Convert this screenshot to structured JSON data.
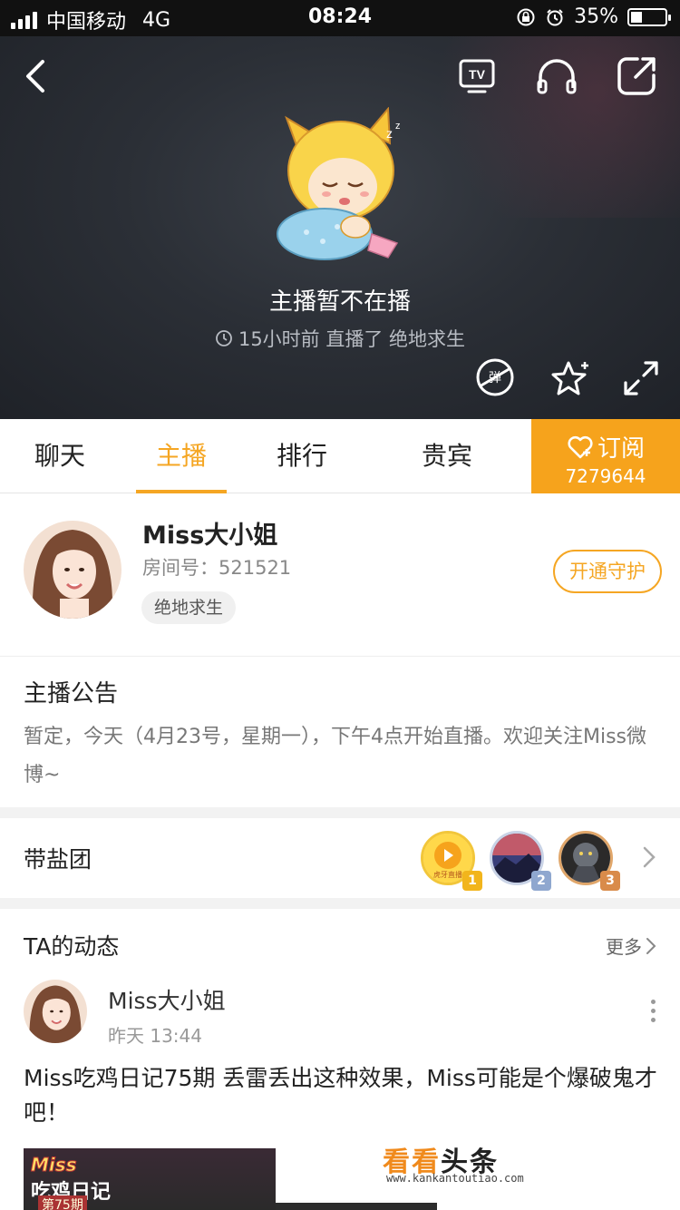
{
  "status_bar": {
    "carrier": "中国移动",
    "network": "4G",
    "time": "08:24",
    "battery": "35%"
  },
  "player": {
    "offline_title": "主播暂不在播",
    "offline_sub": "15小时前 直播了 绝地求生",
    "danmaku_label": "弹"
  },
  "tabs": [
    {
      "label": "聊天"
    },
    {
      "label": "主播"
    },
    {
      "label": "排行"
    },
    {
      "label": "贵宾"
    }
  ],
  "subscribe": {
    "label": "订阅",
    "count": "7279644",
    "color": "#f6a31c"
  },
  "host": {
    "name": "Miss大小姐",
    "room": "房间号：521521",
    "tag": "绝地求生",
    "guard_button": "开通守护"
  },
  "notice": {
    "title": "主播公告",
    "body": "暂定，今天（4月23号，星期一），下午4点开始直播。欢迎关注Miss微博~"
  },
  "fans": {
    "title": "带盐团",
    "ranks": [
      "1",
      "2",
      "3"
    ],
    "badge_text": "虎牙直播"
  },
  "dynamics": {
    "title": "TA的动态",
    "more": "更多",
    "post": {
      "author": "Miss大小姐",
      "time": "昨天 13:44",
      "text": "Miss吃鸡日记75期 丢雷丢出这种效果，Miss可能是个爆破鬼才吧！",
      "thumb_line1": "Miss",
      "thumb_line2": "吃鸡日记",
      "thumb_line3": "第75期"
    }
  },
  "watermark": {
    "part1": "看看",
    "part2": "头条",
    "url": "www.kankantoutiao.com"
  }
}
